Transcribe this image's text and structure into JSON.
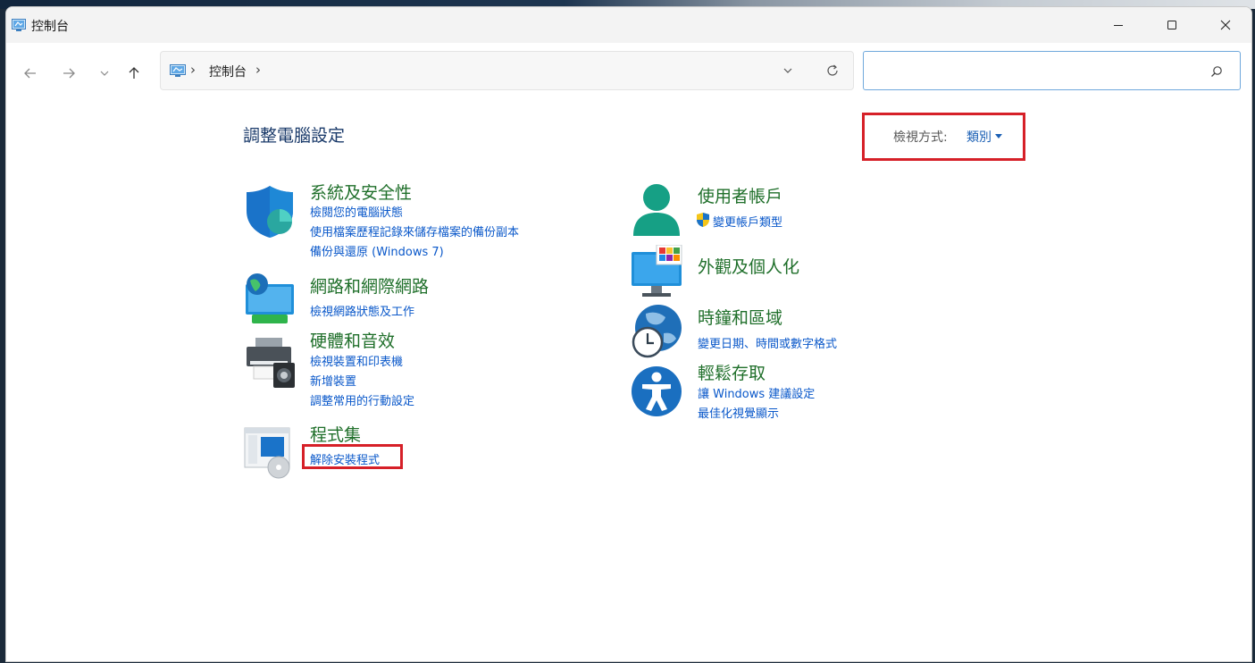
{
  "window": {
    "title": "控制台",
    "controls": {
      "minimize": "—",
      "maximize": "☐",
      "close": "✕"
    }
  },
  "nav": {
    "back_icon": "arrow-left-icon",
    "forward_icon": "arrow-right-icon",
    "recent_icon": "chevron-down-icon",
    "up_icon": "arrow-up-icon"
  },
  "address": {
    "crumb": "控制台",
    "separator": "›"
  },
  "search": {
    "value": "",
    "placeholder": ""
  },
  "content": {
    "title": "調整電腦設定",
    "view_by": {
      "label": "檢視方式:",
      "value": "類別"
    },
    "categories": [
      {
        "title": "系統及安全性",
        "icon": "shield-icon",
        "links": [
          "檢閱您的電腦狀態",
          "使用檔案歷程記錄來儲存檔案的備份副本",
          "備份與還原 (Windows 7)"
        ]
      },
      {
        "title": "網路和網際網路",
        "icon": "network-globe-icon",
        "links": [
          "檢視網路狀態及工作"
        ]
      },
      {
        "title": "硬體和音效",
        "icon": "printer-speaker-icon",
        "links": [
          "檢視裝置和印表機",
          "新增裝置",
          "調整常用的行動設定"
        ]
      },
      {
        "title": "程式集",
        "icon": "programs-disc-icon",
        "links": [
          "解除安裝程式"
        ]
      },
      {
        "title": "使用者帳戶",
        "icon": "user-account-icon",
        "links": [
          "變更帳戶類型"
        ]
      },
      {
        "title": "外觀及個人化",
        "icon": "monitor-personalize-icon",
        "links": []
      },
      {
        "title": "時鐘和區域",
        "icon": "clock-globe-icon",
        "links": [
          "變更日期、時間或數字格式"
        ]
      },
      {
        "title": "輕鬆存取",
        "icon": "accessibility-icon",
        "links": [
          "讓 Windows 建議設定",
          "最佳化視覺顯示"
        ]
      }
    ]
  },
  "colors": {
    "highlight_box": "#d62028",
    "category_title": "#1f6f2a",
    "link": "#0a58ca"
  }
}
